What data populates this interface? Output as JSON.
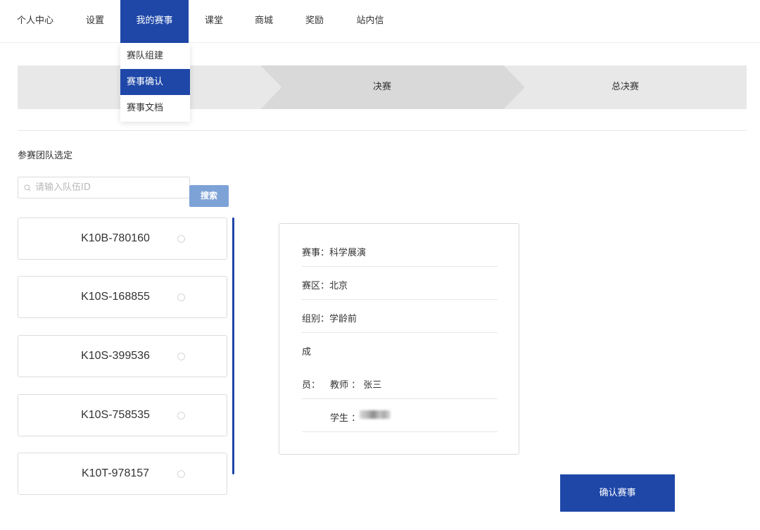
{
  "nav": {
    "items": [
      {
        "label": "个人中心"
      },
      {
        "label": "设置"
      },
      {
        "label": "我的赛事"
      },
      {
        "label": "课堂"
      },
      {
        "label": "商城"
      },
      {
        "label": "奖励"
      },
      {
        "label": "站内信"
      }
    ],
    "active_index": 2
  },
  "dropdown": {
    "items": [
      {
        "label": "赛队组建"
      },
      {
        "label": "赛事确认"
      },
      {
        "label": "赛事文档"
      }
    ],
    "active_index": 1
  },
  "steps": {
    "items": [
      {
        "label": ""
      },
      {
        "label": "决赛"
      },
      {
        "label": "总决赛"
      }
    ]
  },
  "section_title": "参赛团队选定",
  "search": {
    "placeholder": "请输入队伍ID",
    "value": "",
    "button_label": "搜索"
  },
  "teams": [
    {
      "id": "K10B-780160"
    },
    {
      "id": "K10S-168855"
    },
    {
      "id": "K10S-399536"
    },
    {
      "id": "K10S-758535"
    },
    {
      "id": "K10T-978157"
    }
  ],
  "detail": {
    "event": "赛事：科学展演",
    "region": "赛区：北京",
    "group": "组别：学龄前",
    "members_label_1": "成",
    "members_label_2": "员：",
    "teacher": "教师 ： 张三",
    "student_label": "学生 ："
  },
  "confirm_label": "确认赛事",
  "colors": {
    "primary": "#1e47a8",
    "search_button": "#7da2d6",
    "step_bg": "#e8e8e8",
    "step_active_bg": "#d9d9d9"
  }
}
